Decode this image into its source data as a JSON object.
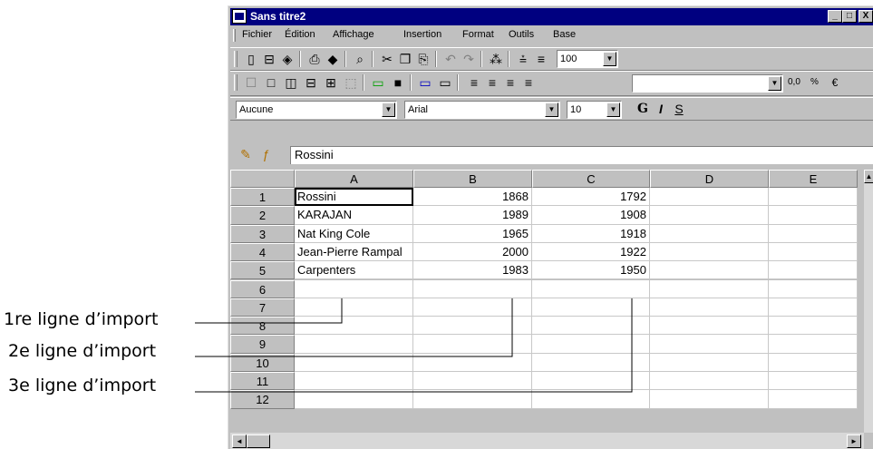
{
  "window": {
    "title": "Sans titre2",
    "controls": [
      "_",
      "□",
      "X"
    ]
  },
  "menubar": {
    "items": [
      "Fichier",
      "Édition",
      "Affichage",
      "Insertion",
      "Format",
      "Outils",
      "Base"
    ]
  },
  "toolbar1": {
    "zoom": "100"
  },
  "toolbar2": {
    "number_format": "0,0",
    "percent": "%"
  },
  "format_bar": {
    "style": "Aucune",
    "font": "Arial",
    "size": "10",
    "bold": "G",
    "italic": "I",
    "underline": "S"
  },
  "formula_bar": {
    "value": "Rossini"
  },
  "sheet": {
    "columns": [
      "A",
      "B",
      "C",
      "D",
      "E"
    ],
    "row_numbers": [
      "1",
      "2",
      "3",
      "4",
      "5",
      "6",
      "7",
      "8",
      "9",
      "10",
      "11",
      "12"
    ],
    "rows": [
      [
        "Rossini",
        "1868",
        "1792"
      ],
      [
        "KARAJAN",
        "1989",
        "1908"
      ],
      [
        "Nat King Cole",
        "1965",
        "1918"
      ],
      [
        "Jean-Pierre Rampal",
        "2000",
        "1922"
      ],
      [
        "Carpenters",
        "1983",
        "1950"
      ]
    ],
    "active_cell": "A1"
  },
  "callouts": [
    "1re ligne d’import",
    "2e ligne d’import",
    "3e ligne d’import"
  ]
}
